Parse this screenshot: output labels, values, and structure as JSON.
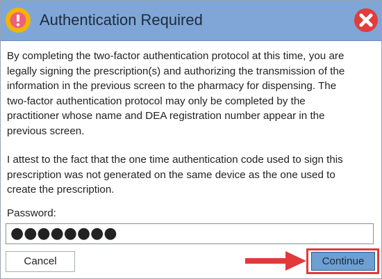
{
  "dialog": {
    "title": "Authentication Required",
    "paragraph1": "By completing the two-factor authentication protocol at this time, you are\nlegally signing the prescription(s) and authorizing the transmission of the\ninformation in the previous screen to the pharmacy for dispensing. The\ntwo-factor authentication protocol may only be completed by the\npractitioner whose name and DEA registration number appear in the\nprevious screen.",
    "paragraph2": "I attest to the fact that the one time authentication code used to sign this\nprescription was not generated on the same device as the one used to\ncreate the prescription.",
    "password_label": "Password:",
    "password_value": "●●●●●●●●",
    "cancel_label": "Cancel",
    "continue_label": "Continue"
  },
  "icons": {
    "title_icon": "warning-icon",
    "close_icon": "close-icon",
    "annotation": "red-arrow-icon"
  },
  "colors": {
    "titlebar": "#7fa6d7",
    "warning_circle": "#f4b400",
    "close_red": "#e23c3c",
    "continue_button": "#6d9fd3",
    "highlight": "#e03a3a"
  }
}
